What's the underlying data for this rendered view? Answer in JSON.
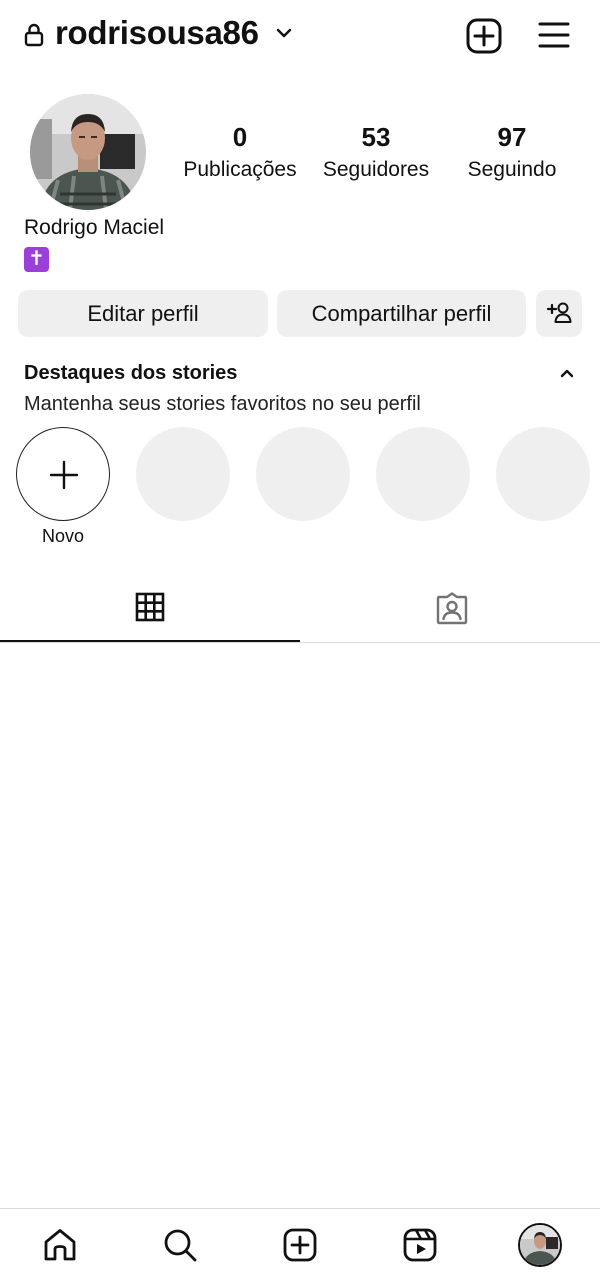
{
  "header": {
    "username": "rodrisousa86"
  },
  "profile": {
    "full_name": "Rodrigo Maciel",
    "bio_emoji": "✝",
    "stats": [
      {
        "value": "0",
        "label": "Publicações"
      },
      {
        "value": "53",
        "label": "Seguidores"
      },
      {
        "value": "97",
        "label": "Seguindo"
      }
    ]
  },
  "actions": {
    "edit_label": "Editar perfil",
    "share_label": "Compartilhar perfil"
  },
  "highlights": {
    "title": "Destaques dos stories",
    "subtitle": "Mantenha seus stories favoritos no seu perfil",
    "new_label": "Novo"
  },
  "icons": {
    "lock": "lock-icon",
    "chevron": "chevron-down-icon",
    "create": "plus-square-icon",
    "menu": "hamburger-menu-icon",
    "add_user": "add-person-icon",
    "collapse": "chevron-up-icon",
    "grid": "grid-icon",
    "tagged": "tagged-user-icon",
    "home": "home-icon",
    "search": "search-icon",
    "reels": "reels-icon"
  },
  "colors": {
    "button_bg": "#efefef",
    "text": "#111111",
    "divider": "#dbdbdb",
    "bio_emoji_bg": "#9b3fd9"
  }
}
